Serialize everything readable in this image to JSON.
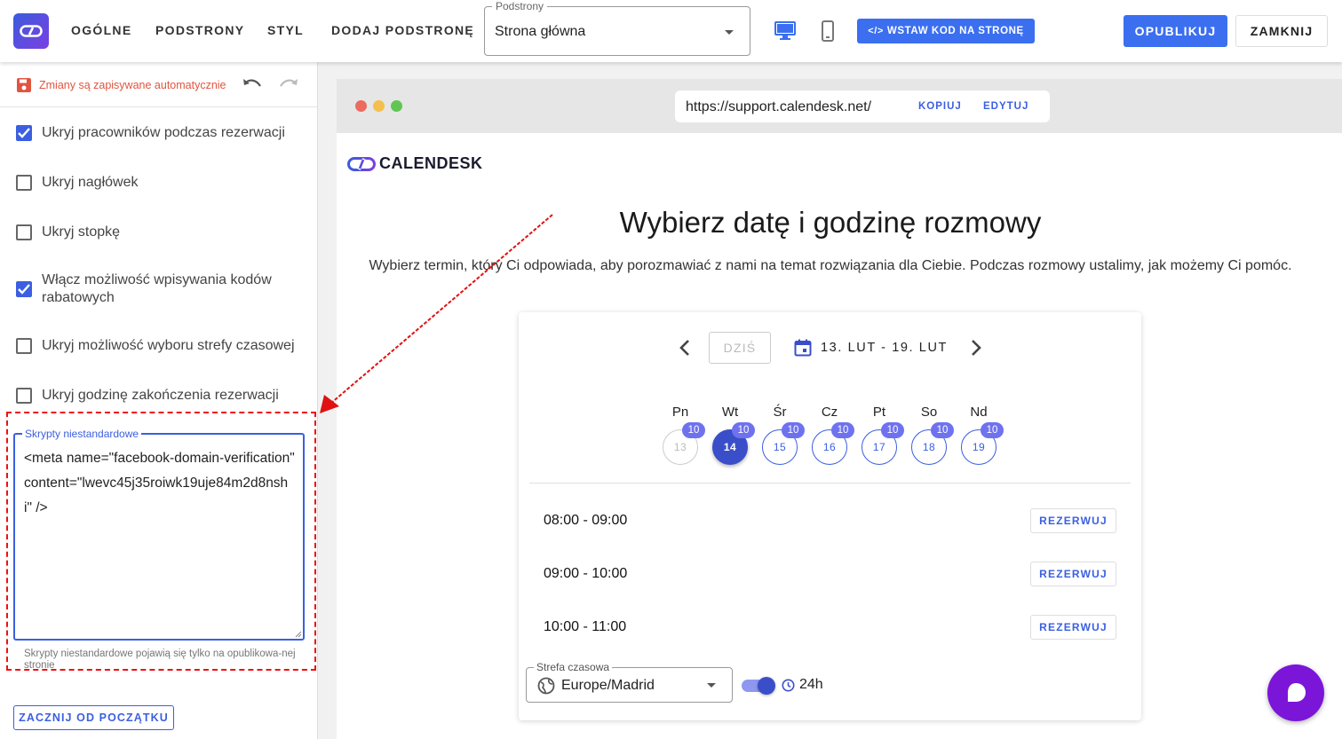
{
  "header": {
    "nav": [
      "OGÓLNE",
      "PODSTRONY",
      "STYL",
      "DODAJ PODSTRONĘ"
    ],
    "subpage_select": {
      "label": "Podstrony",
      "value": "Strona główna"
    },
    "embed_button": "WSTAW KOD NA STRONĘ",
    "publish_button": "OPUBLIKUJ",
    "close_button": "ZAMKNIJ"
  },
  "sidebar": {
    "autosave_text": "Zmiany są zapisywane automatycznie",
    "options": [
      {
        "label": "Ukryj pracowników podczas rezerwacji",
        "checked": true
      },
      {
        "label": "Ukryj nagłówek",
        "checked": false
      },
      {
        "label": "Ukryj stopkę",
        "checked": false
      },
      {
        "label": "Włącz możliwość wpisywania kodów rabatowych",
        "checked": true
      },
      {
        "label": "Ukryj możliwość wyboru strefy czasowej",
        "checked": false
      },
      {
        "label": "Ukryj godzinę zakończenia rezerwacji",
        "checked": false
      }
    ],
    "scripts": {
      "label": "Skrypty niestandardowe",
      "value": "<meta name=\"facebook-domain-verification\" content=\"lwevc45j35roiwk19uje84m2d8nshi\" />",
      "hint": "Skrypty niestandardowe pojawią się tylko na opublikowa-nej stronie"
    },
    "reset_button": "ZACZNIJ OD POCZĄTKU"
  },
  "browser": {
    "url": "https://support.calendesk.net/",
    "copy_label": "KOPIUJ",
    "edit_label": "EDYTUJ"
  },
  "preview": {
    "brand": "CALENDESK",
    "title": "Wybierz datę i godzinę rozmowy",
    "subtitle": "Wybierz termin, który Ci odpowiada, aby porozmawiać z nami na temat rozwiązania dla Ciebie. Podczas rozmowy ustalimy, jak możemy Ci pomóc.",
    "today_button": "DZIŚ",
    "date_range": "13. LUT - 19. LUT",
    "days": [
      {
        "name": "Pn",
        "date": "13",
        "count": "10",
        "state": "disabled"
      },
      {
        "name": "Wt",
        "date": "14",
        "count": "10",
        "state": "selected"
      },
      {
        "name": "Śr",
        "date": "15",
        "count": "10",
        "state": "available"
      },
      {
        "name": "Cz",
        "date": "16",
        "count": "10",
        "state": "available"
      },
      {
        "name": "Pt",
        "date": "17",
        "count": "10",
        "state": "available"
      },
      {
        "name": "So",
        "date": "18",
        "count": "10",
        "state": "available"
      },
      {
        "name": "Nd",
        "date": "19",
        "count": "10",
        "state": "available"
      }
    ],
    "slots": [
      {
        "time": "08:00 - 09:00",
        "button": "REZERWUJ"
      },
      {
        "time": "09:00 - 10:00",
        "button": "REZERWUJ"
      },
      {
        "time": "10:00 - 11:00",
        "button": "REZERWUJ"
      }
    ],
    "timezone": {
      "label": "Strefa czasowa",
      "value": "Europe/Madrid"
    },
    "clock_format": "24h"
  },
  "colors": {
    "accent": "#3b6ff0",
    "annotation": "#e11111",
    "chat": "#7b16d9"
  }
}
